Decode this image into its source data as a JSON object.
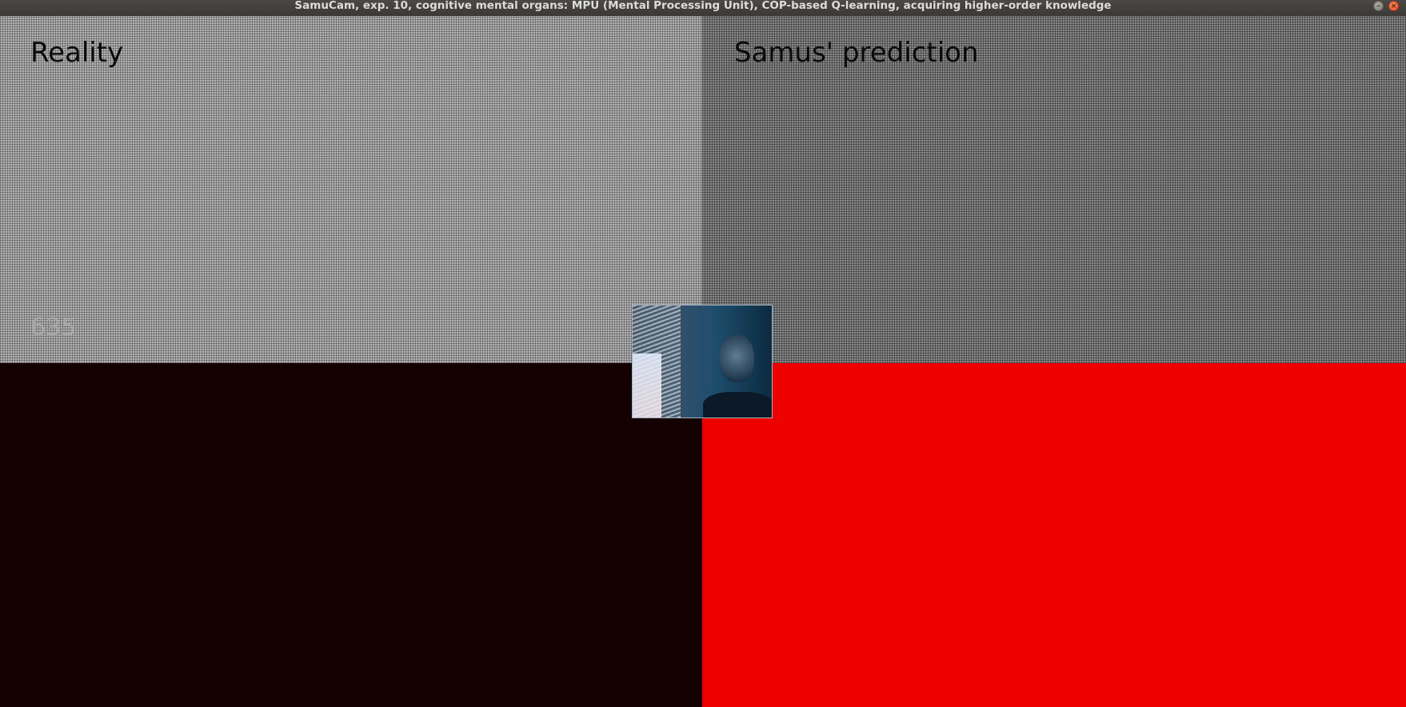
{
  "window": {
    "title": "SamuCam, exp. 10, cognitive mental organs: MPU (Mental Processing Unit), COP-based Q-learning, acquiring higher-order knowledge"
  },
  "panels": {
    "reality": {
      "label": "Reality",
      "counter": "635",
      "top_color": "#b4b4b4",
      "bottom_color": "#140000"
    },
    "prediction": {
      "label": "Samus' prediction",
      "top_color": "#8a8a8a",
      "bottom_color": "#ee0000"
    }
  },
  "webcam": {
    "icon": "webcam-preview"
  },
  "icons": {
    "minimize": "minimize-icon",
    "close": "close-icon"
  }
}
